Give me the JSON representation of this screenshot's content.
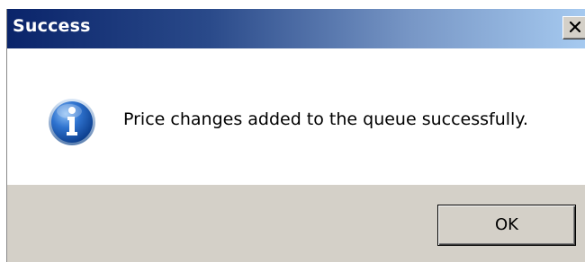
{
  "window": {
    "title": "Success",
    "close_icon": "close-x-icon"
  },
  "content": {
    "icon": "information-icon",
    "message": "Price changes added to the queue successfully."
  },
  "buttons": {
    "ok_label": "OK"
  },
  "colors": {
    "titlebar_start": "#0a246a",
    "titlebar_end": "#a6caf0",
    "footer_bg": "#d4d0c8",
    "icon_blue": "#1f5fb8"
  }
}
